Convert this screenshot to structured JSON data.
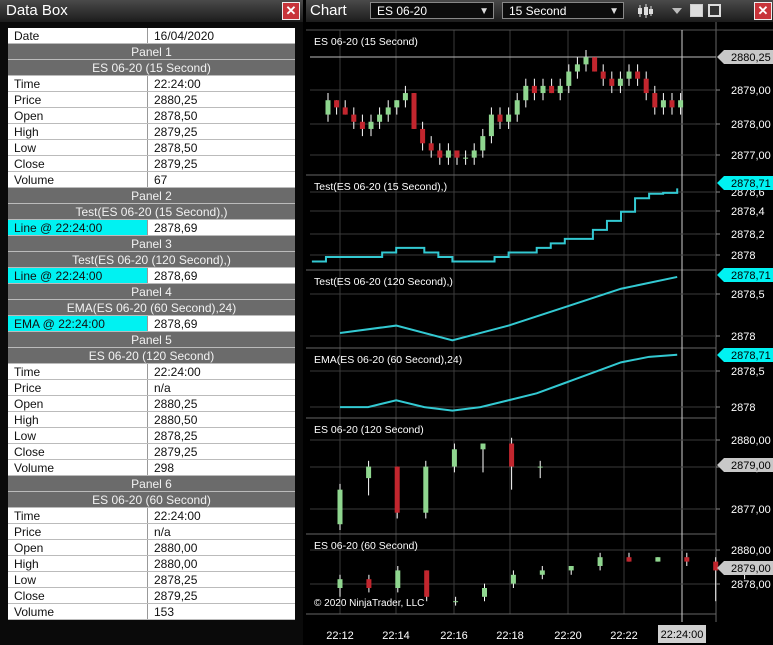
{
  "databox": {
    "title": "Data Box",
    "rows": [
      {
        "type": "kv",
        "label": "Date",
        "value": "16/04/2020"
      },
      {
        "type": "header",
        "label": "Panel 1"
      },
      {
        "type": "header",
        "label": "ES 06-20 (15 Second)"
      },
      {
        "type": "kv",
        "label": "Time",
        "value": "22:24:00"
      },
      {
        "type": "kv",
        "label": "Price",
        "value": "2880,25"
      },
      {
        "type": "kv",
        "label": "Open",
        "value": "2878,50"
      },
      {
        "type": "kv",
        "label": "High",
        "value": "2879,25"
      },
      {
        "type": "kv",
        "label": "Low",
        "value": "2878,50"
      },
      {
        "type": "kv",
        "label": "Close",
        "value": "2879,25"
      },
      {
        "type": "kv",
        "label": "Volume",
        "value": "67"
      },
      {
        "type": "header",
        "label": "Panel 2"
      },
      {
        "type": "header",
        "label": "Test(ES 06-20 (15 Second),)"
      },
      {
        "type": "cyan",
        "label": "Line @ 22:24:00",
        "value": "2878,69"
      },
      {
        "type": "header",
        "label": "Panel 3"
      },
      {
        "type": "header",
        "label": "Test(ES 06-20 (120 Second),)"
      },
      {
        "type": "cyan",
        "label": "Line @ 22:24:00",
        "value": "2878,69"
      },
      {
        "type": "header",
        "label": "Panel 4"
      },
      {
        "type": "header",
        "label": "EMA(ES 06-20 (60 Second),24)"
      },
      {
        "type": "cyan",
        "label": "EMA @ 22:24:00",
        "value": "2878,69"
      },
      {
        "type": "header",
        "label": "Panel 5"
      },
      {
        "type": "header",
        "label": "ES 06-20 (120 Second)"
      },
      {
        "type": "kv",
        "label": "Time",
        "value": "22:24:00"
      },
      {
        "type": "kv",
        "label": "Price",
        "value": "n/a"
      },
      {
        "type": "kv",
        "label": "Open",
        "value": "2880,25"
      },
      {
        "type": "kv",
        "label": "High",
        "value": "2880,50"
      },
      {
        "type": "kv",
        "label": "Low",
        "value": "2878,25"
      },
      {
        "type": "kv",
        "label": "Close",
        "value": "2879,25"
      },
      {
        "type": "kv",
        "label": "Volume",
        "value": "298"
      },
      {
        "type": "header",
        "label": "Panel 6"
      },
      {
        "type": "header",
        "label": "ES 06-20 (60 Second)"
      },
      {
        "type": "kv",
        "label": "Time",
        "value": "22:24:00"
      },
      {
        "type": "kv",
        "label": "Price",
        "value": "n/a"
      },
      {
        "type": "kv",
        "label": "Open",
        "value": "2880,00"
      },
      {
        "type": "kv",
        "label": "High",
        "value": "2880,00"
      },
      {
        "type": "kv",
        "label": "Low",
        "value": "2878,25"
      },
      {
        "type": "kv",
        "label": "Close",
        "value": "2879,25"
      },
      {
        "type": "kv",
        "label": "Volume",
        "value": "153"
      }
    ]
  },
  "chart": {
    "title": "Chart",
    "instrument": "ES 06-20",
    "interval": "15 Second",
    "copyright": "© 2020 NinjaTrader, LLC",
    "x_ticks": [
      "22:12",
      "22:14",
      "22:16",
      "22:18",
      "22:20",
      "22:22"
    ],
    "crosshair_time": "22:24:00",
    "colors": {
      "up": "#8fd68f",
      "down": "#c2262e",
      "wick": "#ffffff",
      "indicator": "#33c9d2",
      "cyan_flag": "#00f2f2",
      "price_flag": "#c8c8c8"
    },
    "panels": [
      {
        "label": "ES 06-20 (15 Second)",
        "ticks": [
          "2879,00",
          "2878,00",
          "2877,00"
        ],
        "flag": "2880,25"
      },
      {
        "label": "Test(ES 06-20 (15 Second),)",
        "ticks": [
          "2878,6",
          "2878,4",
          "2878,2",
          "2878"
        ],
        "flag": "2878,71"
      },
      {
        "label": "Test(ES 06-20 (120 Second),)",
        "ticks": [
          "2878,5",
          "2878"
        ],
        "flag": "2878,71"
      },
      {
        "label": "EMA(ES 06-20 (60 Second),24)",
        "ticks": [
          "2878,5",
          "2878"
        ],
        "flag": "2878,71"
      },
      {
        "label": "ES 06-20 (120 Second)",
        "ticks": [
          "2880,00",
          "2878,00",
          "2877,00"
        ],
        "flag": "2879,00"
      },
      {
        "label": "ES 06-20 (60 Second)",
        "ticks": [
          "2880,00",
          "2878,00"
        ],
        "flag": "2879,00"
      }
    ],
    "chart_data": [
      {
        "type": "candlestick",
        "title": "ES 06-20 (15 Second)",
        "ylim": [
          2876.5,
          2880.75
        ],
        "candles": [
          [
            2878.5,
            2879.25,
            2878.25,
            2879.0
          ],
          [
            2879.0,
            2879.0,
            2878.5,
            2878.75
          ],
          [
            2878.75,
            2879.0,
            2878.5,
            2878.5
          ],
          [
            2878.5,
            2878.75,
            2878.0,
            2878.25
          ],
          [
            2878.25,
            2878.5,
            2877.75,
            2878.0
          ],
          [
            2878.0,
            2878.5,
            2877.75,
            2878.25
          ],
          [
            2878.25,
            2878.75,
            2878.0,
            2878.5
          ],
          [
            2878.5,
            2879.0,
            2878.25,
            2878.75
          ],
          [
            2878.75,
            2879.0,
            2878.5,
            2879.0
          ],
          [
            2879.0,
            2879.5,
            2878.75,
            2879.25
          ],
          [
            2879.25,
            2879.25,
            2878.0,
            2878.0
          ],
          [
            2878.0,
            2878.25,
            2877.25,
            2877.5
          ],
          [
            2877.5,
            2877.75,
            2877.0,
            2877.25
          ],
          [
            2877.25,
            2877.5,
            2876.75,
            2877.0
          ],
          [
            2877.0,
            2877.5,
            2876.75,
            2877.25
          ],
          [
            2877.25,
            2877.25,
            2876.75,
            2877.0
          ],
          [
            2877.0,
            2877.25,
            2876.75,
            2877.0
          ],
          [
            2877.0,
            2877.5,
            2876.75,
            2877.25
          ],
          [
            2877.25,
            2878.0,
            2877.0,
            2877.75
          ],
          [
            2877.75,
            2878.75,
            2877.5,
            2878.5
          ],
          [
            2878.5,
            2878.75,
            2878.0,
            2878.25
          ],
          [
            2878.25,
            2878.75,
            2878.0,
            2878.5
          ],
          [
            2878.5,
            2879.25,
            2878.25,
            2879.0
          ],
          [
            2879.0,
            2879.75,
            2878.75,
            2879.5
          ],
          [
            2879.5,
            2879.75,
            2879.0,
            2879.25
          ],
          [
            2879.25,
            2879.75,
            2879.0,
            2879.5
          ],
          [
            2879.5,
            2879.75,
            2879.25,
            2879.25
          ],
          [
            2879.25,
            2879.75,
            2879.0,
            2879.5
          ],
          [
            2879.5,
            2880.25,
            2879.25,
            2880.0
          ],
          [
            2880.0,
            2880.5,
            2879.75,
            2880.25
          ],
          [
            2880.25,
            2880.75,
            2880.0,
            2880.5
          ],
          [
            2880.5,
            2880.5,
            2880.0,
            2880.0
          ],
          [
            2880.0,
            2880.25,
            2879.5,
            2879.75
          ],
          [
            2879.75,
            2880.0,
            2879.25,
            2879.5
          ],
          [
            2879.5,
            2880.0,
            2879.25,
            2879.75
          ],
          [
            2879.75,
            2880.25,
            2879.5,
            2880.0
          ],
          [
            2880.0,
            2880.25,
            2879.5,
            2879.75
          ],
          [
            2879.75,
            2880.0,
            2879.0,
            2879.25
          ],
          [
            2879.25,
            2879.5,
            2878.5,
            2878.75
          ],
          [
            2878.75,
            2879.25,
            2878.5,
            2879.0
          ],
          [
            2879.0,
            2879.25,
            2878.5,
            2878.75
          ],
          [
            2878.75,
            2879.25,
            2878.5,
            2879.0
          ]
        ]
      },
      {
        "type": "line",
        "title": "Test(ES 06-20 (15 Second),)",
        "ylim": [
          2877.85,
          2878.78
        ],
        "x": [
          "22:11",
          "22:11:30",
          "22:12",
          "22:13",
          "22:13:30",
          "22:14",
          "22:14:30",
          "22:15",
          "22:15:30",
          "22:16",
          "22:17",
          "22:17:30",
          "22:18",
          "22:19",
          "22:19:30",
          "22:20",
          "22:21",
          "22:21:30",
          "22:22",
          "22:22:30",
          "22:23",
          "22:23:30",
          "22:24"
        ],
        "values": [
          2877.9,
          2877.95,
          2877.95,
          2877.95,
          2878.0,
          2878.05,
          2878.05,
          2878.0,
          2877.95,
          2877.9,
          2877.9,
          2877.95,
          2878.0,
          2878.05,
          2878.1,
          2878.15,
          2878.25,
          2878.35,
          2878.45,
          2878.6,
          2878.65,
          2878.66,
          2878.71
        ]
      },
      {
        "type": "line",
        "title": "Test(ES 06-20 (120 Second),)",
        "ylim": [
          2877.8,
          2878.75
        ],
        "x": [
          "22:12",
          "22:14",
          "22:16",
          "22:18",
          "22:20",
          "22:22",
          "22:24"
        ],
        "values": [
          2877.95,
          2878.05,
          2877.85,
          2878.05,
          2878.3,
          2878.55,
          2878.71
        ]
      },
      {
        "type": "line",
        "title": "EMA(ES 06-20 (60 Second),24)",
        "ylim": [
          2877.85,
          2878.75
        ],
        "x": [
          "22:12",
          "22:13",
          "22:14",
          "22:15",
          "22:16",
          "22:17",
          "22:18",
          "22:19",
          "22:20",
          "22:21",
          "22:22",
          "22:23",
          "22:24"
        ],
        "values": [
          2877.95,
          2877.95,
          2878.05,
          2877.95,
          2877.9,
          2877.95,
          2878.05,
          2878.15,
          2878.3,
          2878.45,
          2878.6,
          2878.68,
          2878.71
        ]
      },
      {
        "type": "candlestick",
        "title": "ES 06-20 (120 Second)",
        "ylim": [
          2876.5,
          2880.75
        ],
        "candles": [
          [
            2876.75,
            2878.5,
            2876.5,
            2878.25
          ],
          [
            2878.75,
            2879.5,
            2878.0,
            2879.25
          ],
          [
            2879.25,
            2879.25,
            2877.0,
            2877.25
          ],
          [
            2877.25,
            2879.5,
            2877.0,
            2879.25
          ],
          [
            2879.25,
            2880.25,
            2879.0,
            2880.0
          ],
          [
            2880.0,
            2880.25,
            2879.0,
            2880.25
          ],
          [
            2880.25,
            2880.5,
            2878.25,
            2879.25
          ],
          [
            2879.25,
            2879.5,
            2878.75,
            2879.25
          ]
        ]
      },
      {
        "type": "candlestick",
        "title": "ES 06-20 (60 Second)",
        "ylim": [
          2877.0,
          2880.75
        ],
        "candles": [
          [
            2878.25,
            2879.0,
            2877.75,
            2878.75
          ],
          [
            2878.75,
            2879.0,
            2878.0,
            2878.25
          ],
          [
            2878.25,
            2879.5,
            2878.0,
            2879.25
          ],
          [
            2879.25,
            2879.25,
            2877.5,
            2877.75
          ],
          [
            2877.5,
            2877.75,
            2877.25,
            2877.5
          ],
          [
            2877.75,
            2878.5,
            2877.5,
            2878.25
          ],
          [
            2878.5,
            2879.25,
            2878.25,
            2879.0
          ],
          [
            2879.0,
            2879.5,
            2878.75,
            2879.25
          ],
          [
            2879.25,
            2879.5,
            2879.0,
            2879.5
          ],
          [
            2879.5,
            2880.25,
            2879.25,
            2880.0
          ],
          [
            2880.0,
            2880.25,
            2879.75,
            2879.75
          ],
          [
            2879.75,
            2880.0,
            2879.75,
            2880.0
          ],
          [
            2880.0,
            2880.25,
            2879.5,
            2879.75
          ],
          [
            2879.75,
            2880.0,
            2877.5,
            2879.25
          ],
          [
            2879.25,
            2879.5,
            2878.75,
            2879.25
          ]
        ]
      }
    ]
  }
}
